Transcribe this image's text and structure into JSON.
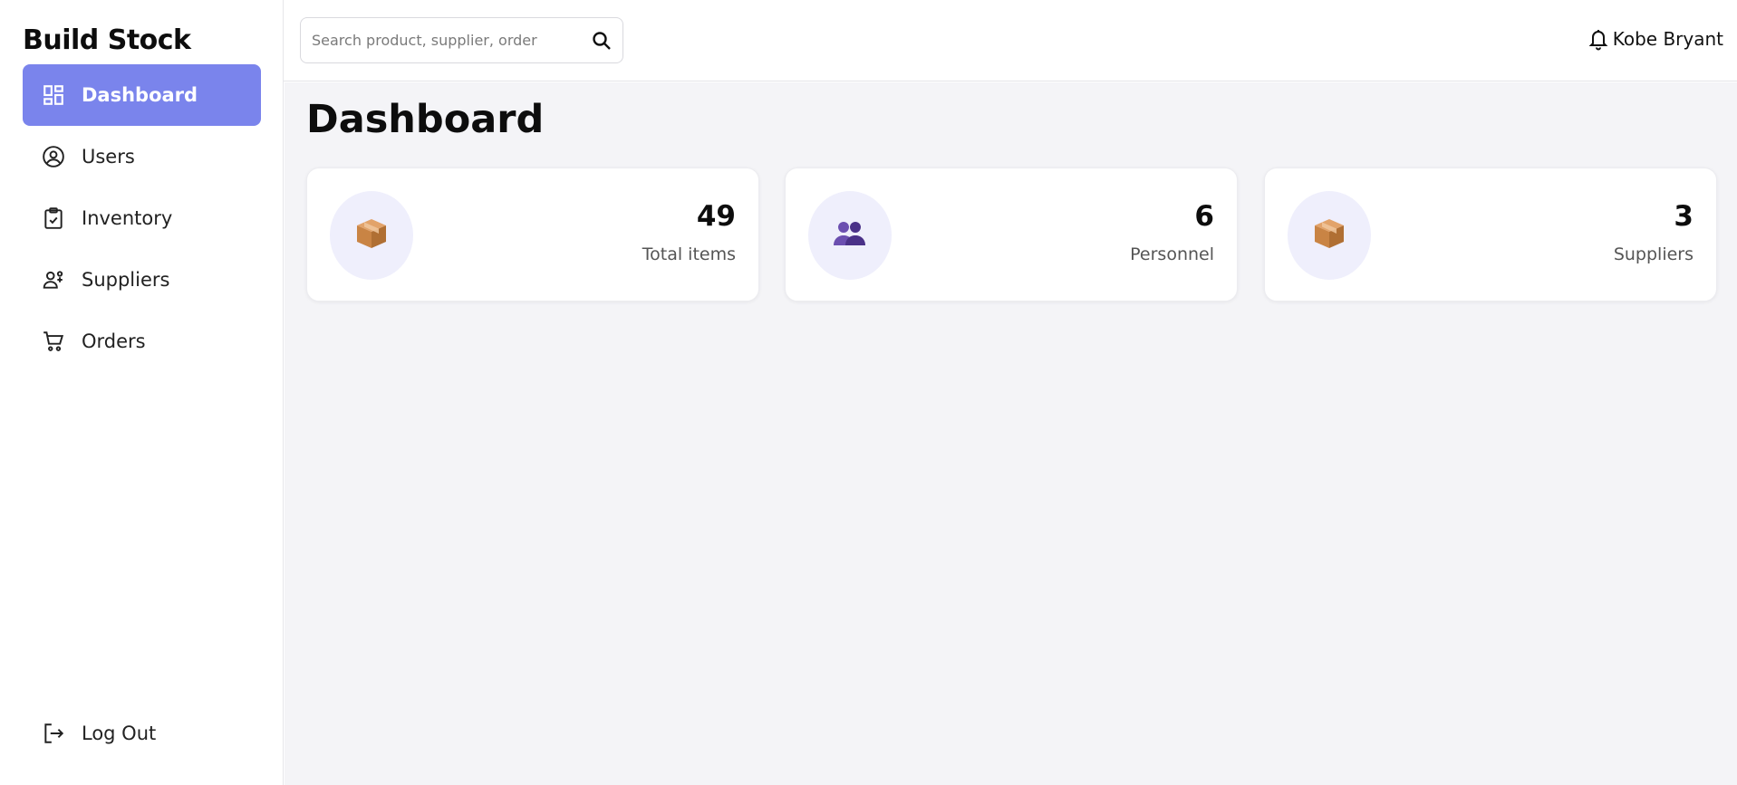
{
  "app": {
    "brand": "Build Stock"
  },
  "sidebar": {
    "items": [
      {
        "label": "Dashboard",
        "icon": "dashboard-icon",
        "active": true
      },
      {
        "label": "Users",
        "icon": "user-circle-icon",
        "active": false
      },
      {
        "label": "Inventory",
        "icon": "clipboard-check-icon",
        "active": false
      },
      {
        "label": "Suppliers",
        "icon": "suppliers-icon",
        "active": false
      },
      {
        "label": "Orders",
        "icon": "cart-icon",
        "active": false
      }
    ],
    "logout_label": "Log Out"
  },
  "topbar": {
    "search_placeholder": "Search product, supplier, order",
    "user_name": "Kobe Bryant"
  },
  "main": {
    "title": "Dashboard",
    "cards": [
      {
        "value": "49",
        "label": "Total items",
        "icon": "package-icon"
      },
      {
        "value": "6",
        "label": "Personnel",
        "icon": "people-icon"
      },
      {
        "value": "3",
        "label": "Suppliers",
        "icon": "package-icon"
      }
    ]
  },
  "colors": {
    "accent": "#7a84ec",
    "background": "#f4f4f7",
    "icon_circle": "#efeffc"
  }
}
